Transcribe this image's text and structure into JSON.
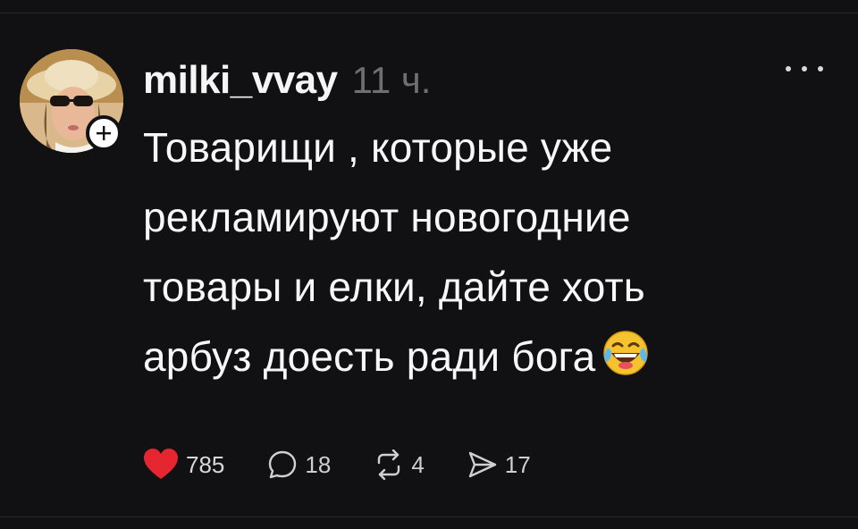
{
  "post": {
    "username": "milki_vvay",
    "timestamp": "11 ч.",
    "text": "Товарищи , которые уже\nрекламируют  новогодние\nтовары и елки, дайте хоть\nарбуз доесть ради бога",
    "emoji": "face-with-tears-of-joy",
    "liked": true
  },
  "actions": {
    "likes": "785",
    "replies": "18",
    "reposts": "4",
    "shares": "17"
  },
  "colors": {
    "background": "#111013",
    "like_red": "#e5252f",
    "muted": "#6f6e73"
  },
  "icons": {
    "like": "heart-icon",
    "reply": "speech-bubble-icon",
    "repost": "repost-arrows-icon",
    "share": "send-icon",
    "more": "more-dots-icon",
    "follow": "plus-icon"
  }
}
